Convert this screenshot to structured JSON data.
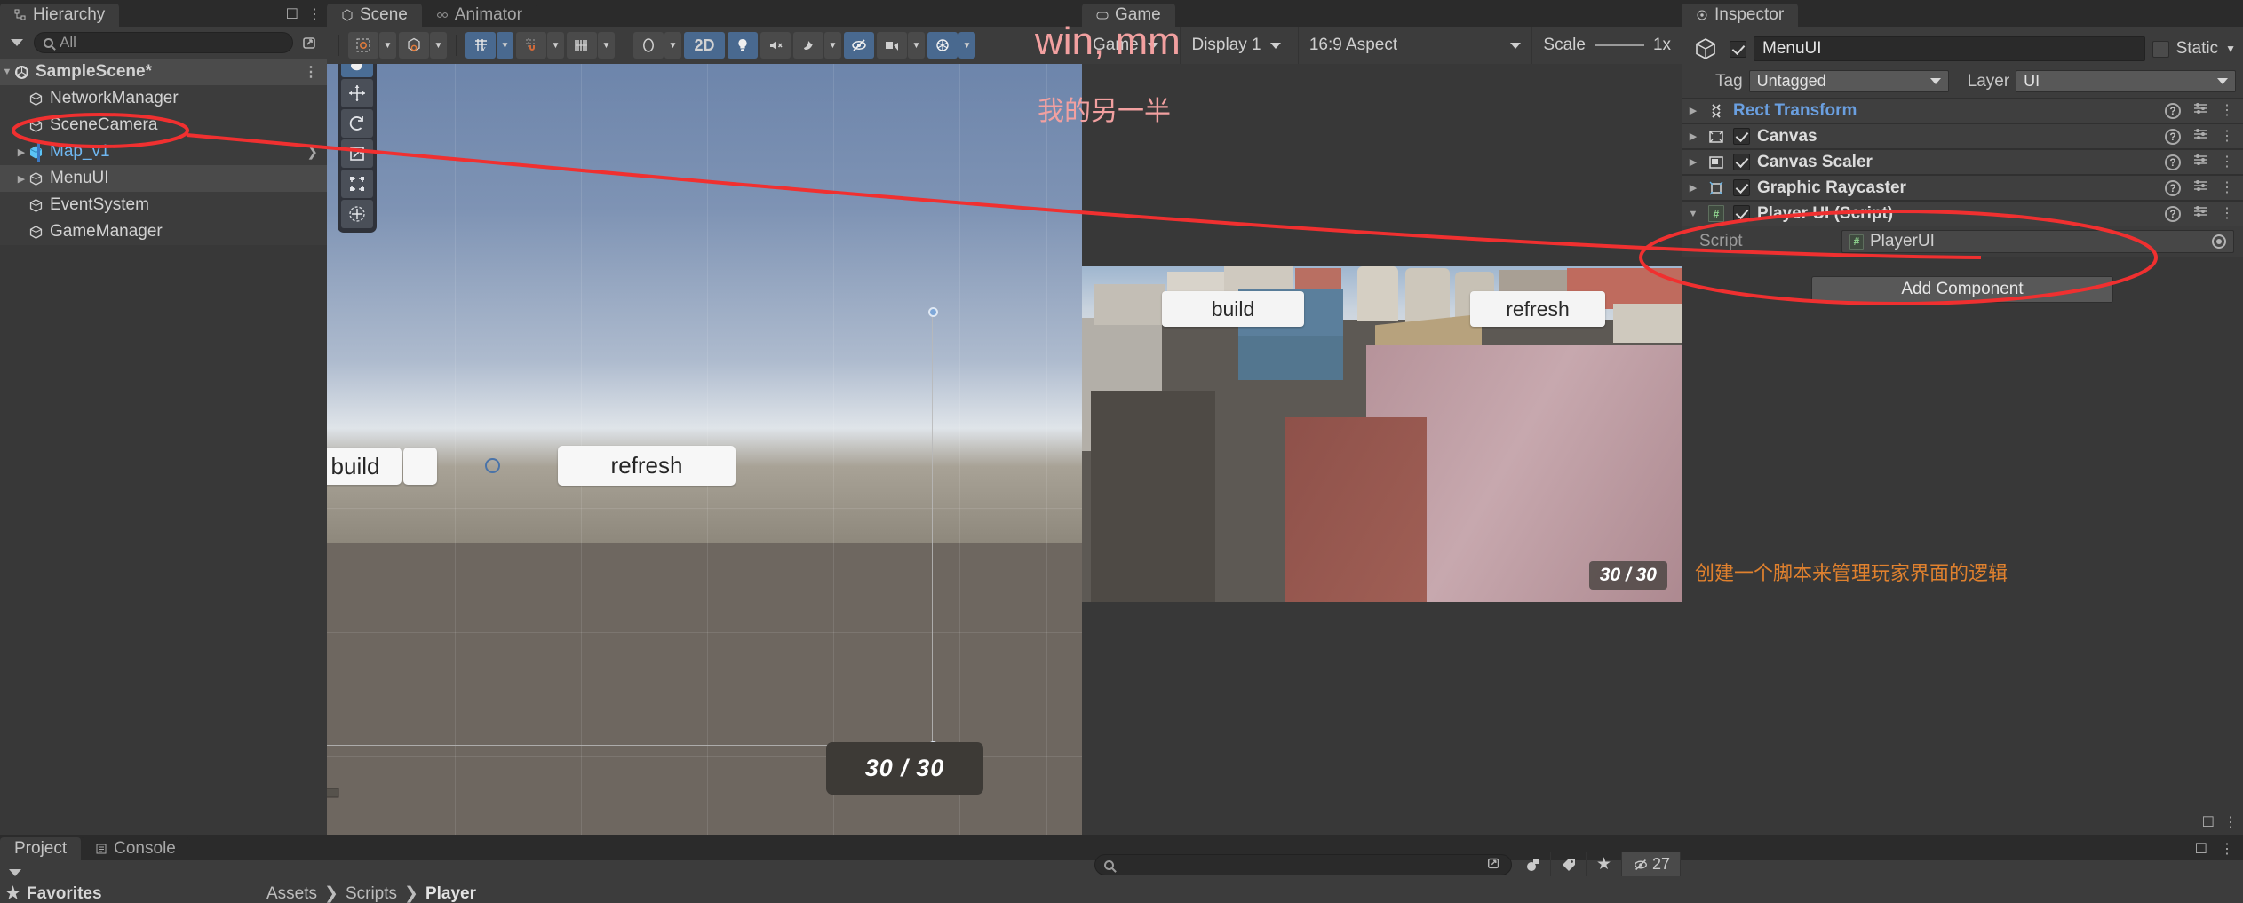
{
  "hierarchy": {
    "tab_label": "Hierarchy",
    "search": {
      "value": "All",
      "icon": "search-icon"
    },
    "scene_name": "SampleScene*",
    "items": [
      {
        "label": "NetworkManager",
        "icon": "gameobject-cube-icon",
        "expandable": false,
        "selected": false
      },
      {
        "label": "SceneCamera",
        "icon": "gameobject-cube-icon",
        "expandable": false,
        "selected": false
      },
      {
        "label": "Map_v1",
        "icon": "prefab-cube-icon",
        "expandable": true,
        "selected": false,
        "prefab": true
      },
      {
        "label": "MenuUI",
        "icon": "gameobject-cube-icon",
        "expandable": true,
        "selected": true
      },
      {
        "label": "EventSystem",
        "icon": "gameobject-cube-icon",
        "expandable": false,
        "selected": false
      },
      {
        "label": "GameManager",
        "icon": "gameobject-cube-icon",
        "expandable": false,
        "selected": false
      }
    ]
  },
  "scene_panel": {
    "tabs": [
      {
        "label": "Scene",
        "active": true,
        "icon": "scene-icon"
      },
      {
        "label": "Animator",
        "active": false,
        "icon": "animator-icon"
      }
    ],
    "toolbar": {
      "pivot_mode": "Center",
      "handle_mode": "Global",
      "grid_toggle": "grid-snap-icon",
      "magnet_toggle": "magnet-snap-icon",
      "layers_toggle": "layers-icon",
      "shading_mode": "Shaded",
      "two_d_label": "2D",
      "lighting_toggle": "light-bulb-icon",
      "audio_toggle": "audio-mute-icon",
      "fx_toggle": "effects-icon",
      "hidden_toggle": "visibility-off-icon",
      "camera_toggle": "scene-camera-icon",
      "gizmos_toggle": "gizmos-icon"
    },
    "tools": [
      {
        "name": "hand-tool",
        "active": true
      },
      {
        "name": "move-tool",
        "active": false
      },
      {
        "name": "rotate-tool",
        "active": false
      },
      {
        "name": "scale-tool",
        "active": false
      },
      {
        "name": "rect-tool",
        "active": false
      },
      {
        "name": "transform-tool",
        "active": false
      }
    ],
    "ui_elements": {
      "build_button": "build",
      "refresh_button": "refresh",
      "ammo_label": "30 / 30"
    }
  },
  "game_panel": {
    "tab_label": "Game",
    "toolbar": {
      "view_mode": "Game",
      "display": "Display 1",
      "aspect": "16:9 Aspect",
      "scale_label": "Scale",
      "scale_value": "1x"
    },
    "overlay": {
      "build_button": "build",
      "refresh_button": "refresh",
      "ammo_label": "30 / 30"
    }
  },
  "inspector": {
    "tab_label": "Inspector",
    "object_name": "MenuUI",
    "enabled": true,
    "static_label": "Static",
    "tag_label": "Tag",
    "tag_value": "Untagged",
    "layer_label": "Layer",
    "layer_value": "UI",
    "components": [
      {
        "name": "Rect Transform",
        "icon": "rect-transform-icon",
        "has_checkbox": false,
        "checked": false,
        "link_color": true,
        "expanded": false
      },
      {
        "name": "Canvas",
        "icon": "canvas-icon",
        "has_checkbox": true,
        "checked": true,
        "link_color": false,
        "expanded": false
      },
      {
        "name": "Canvas Scaler",
        "icon": "canvas-scaler-icon",
        "has_checkbox": true,
        "checked": true,
        "link_color": false,
        "expanded": false
      },
      {
        "name": "Graphic Raycaster",
        "icon": "graphic-raycaster-icon",
        "has_checkbox": true,
        "checked": true,
        "link_color": false,
        "expanded": false
      },
      {
        "name": "Player UI (Script)",
        "icon": "csharp-script-icon",
        "has_checkbox": true,
        "checked": true,
        "link_color": false,
        "expanded": true
      }
    ],
    "script_field": {
      "label": "Script",
      "value": "PlayerUI",
      "icon": "csharp-script-icon"
    },
    "add_component_label": "Add Component"
  },
  "project_panel": {
    "tabs": [
      {
        "label": "Project",
        "active": true
      },
      {
        "label": "Console",
        "active": false,
        "icon": "console-icon"
      }
    ],
    "favorites_label": "Favorites",
    "breadcrumb": [
      "Assets",
      "Scripts",
      "Player"
    ],
    "search_placeholder": "",
    "visible_count": "27",
    "icon_buttons": [
      "asset-type-icon",
      "label-tag-icon",
      "favorite-star-icon",
      "hidden-count-icon"
    ]
  },
  "annotations": {
    "pink_line1": "win, mm",
    "pink_line2": "我的另一半",
    "orange_note": "创建一个脚本来管理玩家界面的逻辑",
    "accent_red": "#f03030",
    "accent_pink": "#f2a0a0",
    "accent_orange": "#e0812e"
  }
}
